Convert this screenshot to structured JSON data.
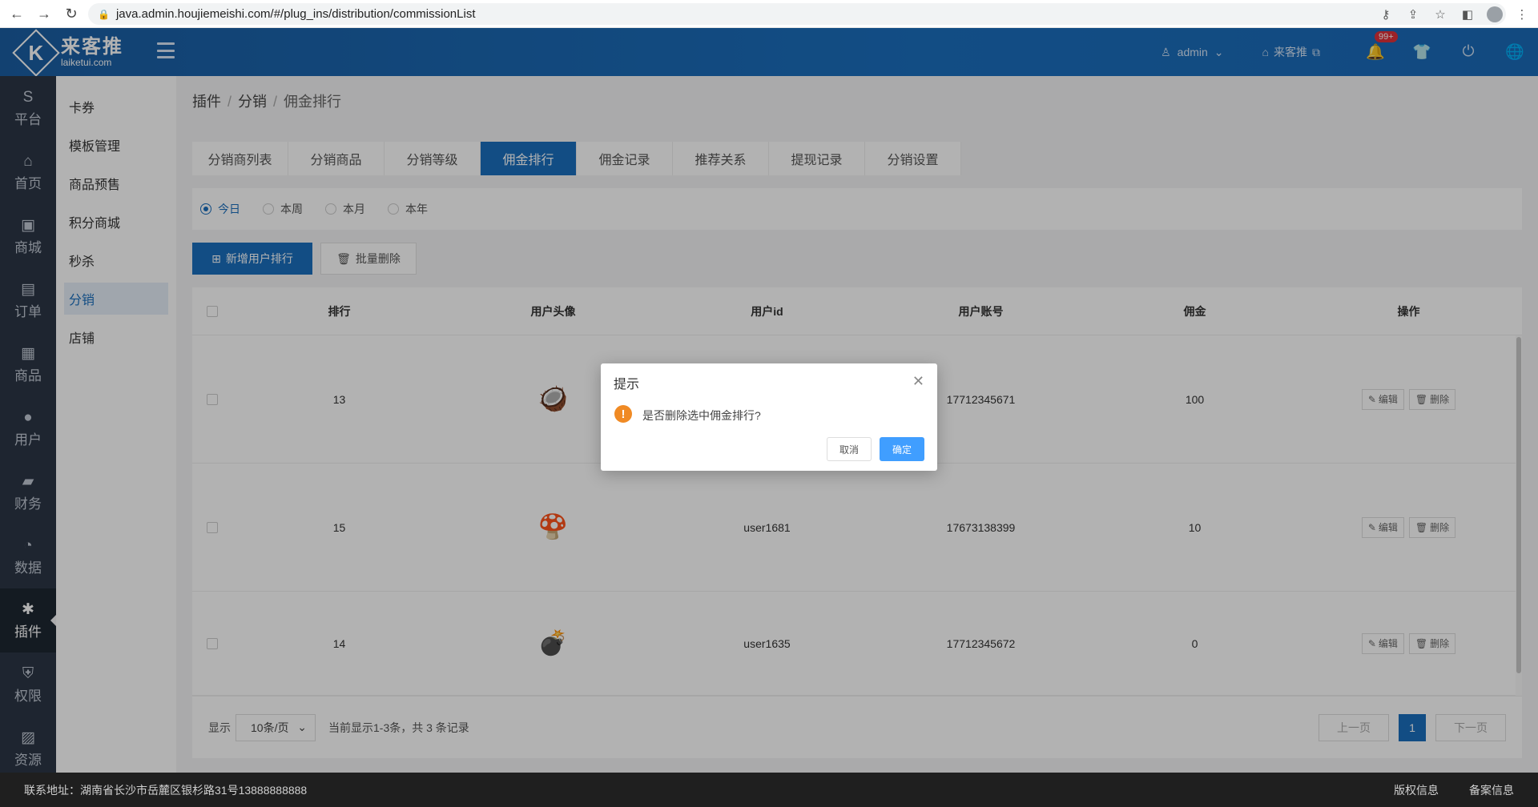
{
  "browser": {
    "url": "java.admin.houjiemeishi.com/#/plug_ins/distribution/commissionList"
  },
  "header": {
    "logo_cn": "来客推",
    "logo_en": "laiketui.com",
    "user": "admin",
    "store": "来客推",
    "notif_badge": "99+"
  },
  "left_nav": {
    "items": [
      {
        "label": "平台",
        "icon": "S"
      },
      {
        "label": "首页",
        "icon": "⌂"
      },
      {
        "label": "商城",
        "icon": "▣"
      },
      {
        "label": "订单",
        "icon": "▤"
      },
      {
        "label": "商品",
        "icon": "▦"
      },
      {
        "label": "用户",
        "icon": "●"
      },
      {
        "label": "财务",
        "icon": "▰"
      },
      {
        "label": "数据",
        "icon": "◔"
      },
      {
        "label": "插件",
        "icon": "✱"
      },
      {
        "label": "权限",
        "icon": "⛨"
      },
      {
        "label": "资源",
        "icon": "▨"
      }
    ]
  },
  "sub_nav": {
    "items": [
      "卡券",
      "模板管理",
      "商品预售",
      "积分商城",
      "秒杀",
      "分销",
      "店铺"
    ]
  },
  "breadcrumb": [
    "插件",
    "分销",
    "佣金排行"
  ],
  "tabs": [
    "分销商列表",
    "分销商品",
    "分销等级",
    "佣金排行",
    "佣金记录",
    "推荐关系",
    "提现记录",
    "分销设置"
  ],
  "filter": [
    "今日",
    "本周",
    "本月",
    "本年"
  ],
  "actions": {
    "add": "新增用户排行",
    "batch_delete": "批量删除"
  },
  "table": {
    "headers": [
      "排行",
      "用户头像",
      "用户id",
      "用户账号",
      "佣金",
      "操作"
    ],
    "rows": [
      {
        "rank": "13",
        "user_id": "",
        "account": "17712345671",
        "commission": "100"
      },
      {
        "rank": "15",
        "user_id": "user1681",
        "account": "17673138399",
        "commission": "10"
      },
      {
        "rank": "14",
        "user_id": "user1635",
        "account": "17712345672",
        "commission": "0"
      }
    ],
    "edit": "编辑",
    "delete": "删除"
  },
  "pager": {
    "show": "显示",
    "page_size": "10条/页",
    "summary": "当前显示1-3条，共 3 条记录",
    "prev": "上一页",
    "current": "1",
    "next": "下一页"
  },
  "dialog": {
    "title": "提示",
    "message": "是否删除选中佣金排行?",
    "cancel": "取消",
    "confirm": "确定"
  },
  "footer": {
    "address": "联系地址：湖南省长沙市岳麓区银杉路31号13888888888",
    "copyright": "版权信息",
    "record": "备案信息"
  },
  "colors": {
    "primary": "#1b6fbe",
    "nav_dark": "#2b3645",
    "warning": "#f08a24",
    "confirm": "#409eff"
  }
}
